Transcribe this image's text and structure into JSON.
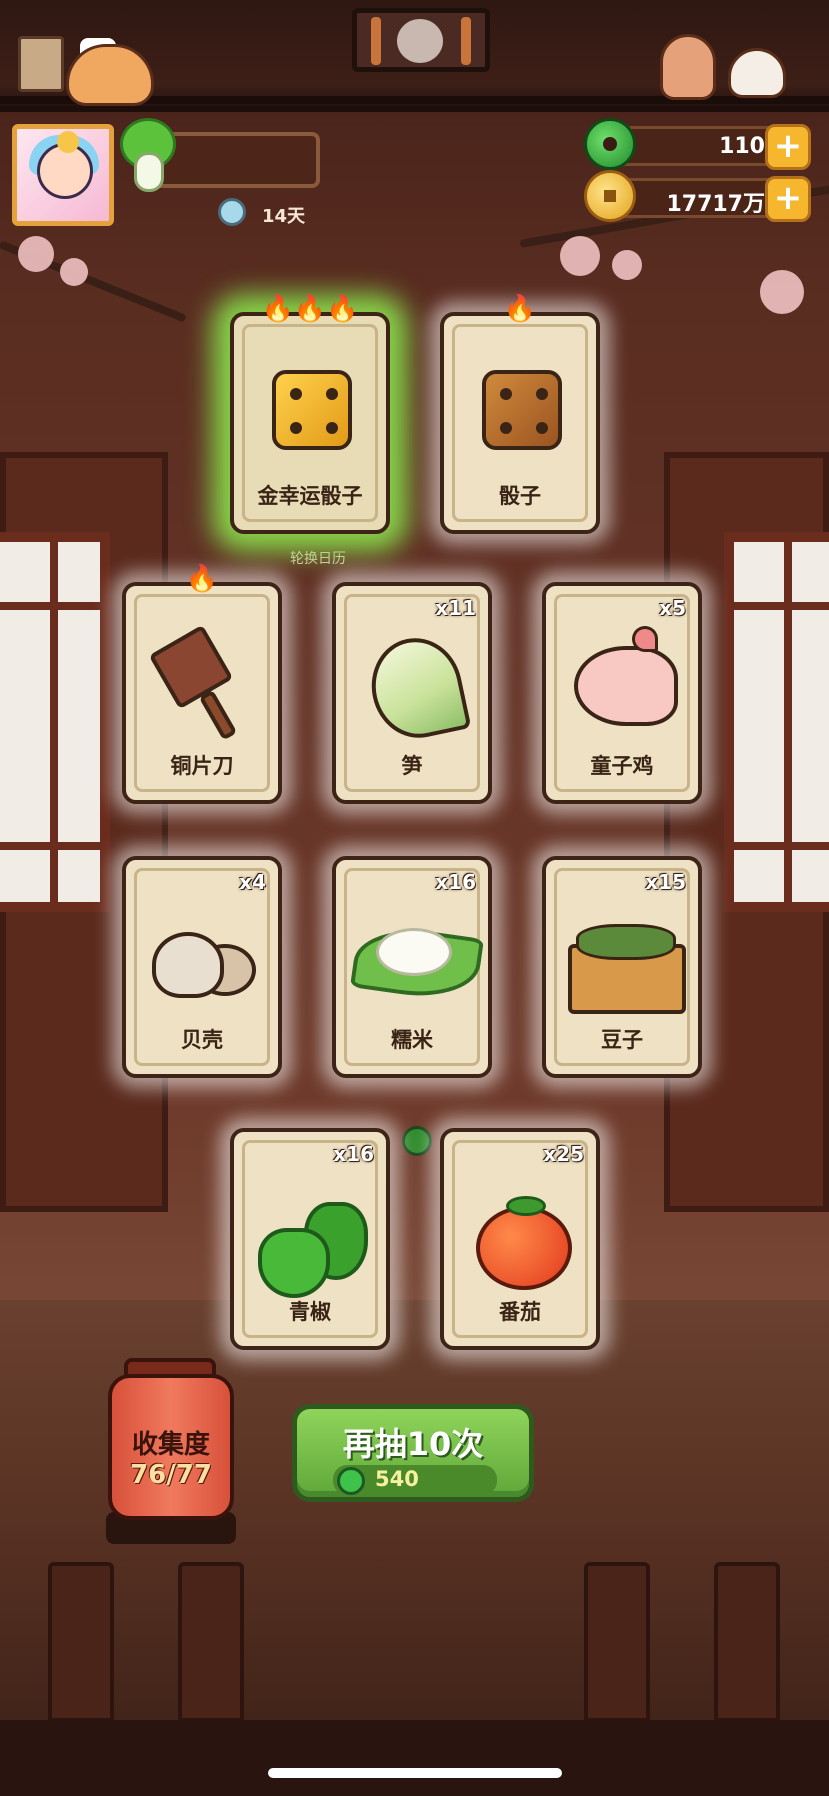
{
  "header": {
    "days_label": "14天"
  },
  "currencies": {
    "jade": "110",
    "coins": "17717万"
  },
  "cards": [
    {
      "name": "金幸运骰子",
      "count": "",
      "flames": "🔥🔥🔥",
      "highlight": "green"
    },
    {
      "name": "骰子",
      "count": "",
      "flames": "🔥"
    },
    {
      "name": "铜片刀",
      "count": "",
      "flames": "🔥"
    },
    {
      "name": "笋",
      "count": "x11",
      "flames": ""
    },
    {
      "name": "童子鸡",
      "count": "x5",
      "flames": ""
    },
    {
      "name": "贝壳",
      "count": "x4",
      "flames": ""
    },
    {
      "name": "糯米",
      "count": "x16",
      "flames": ""
    },
    {
      "name": "豆子",
      "count": "x15",
      "flames": ""
    },
    {
      "name": "青椒",
      "count": "x16",
      "flames": ""
    },
    {
      "name": "番茄",
      "count": "x25",
      "flames": ""
    }
  ],
  "background_label": "轮换日历",
  "collection": {
    "title": "收集度",
    "value": "76/77"
  },
  "redraw_button": {
    "label": "再抽10次",
    "cost": "540"
  },
  "colors": {
    "accent_green": "#5fa73a",
    "gold": "#f6b62d",
    "card": "#efe2c4",
    "lantern": "#d8513a"
  }
}
